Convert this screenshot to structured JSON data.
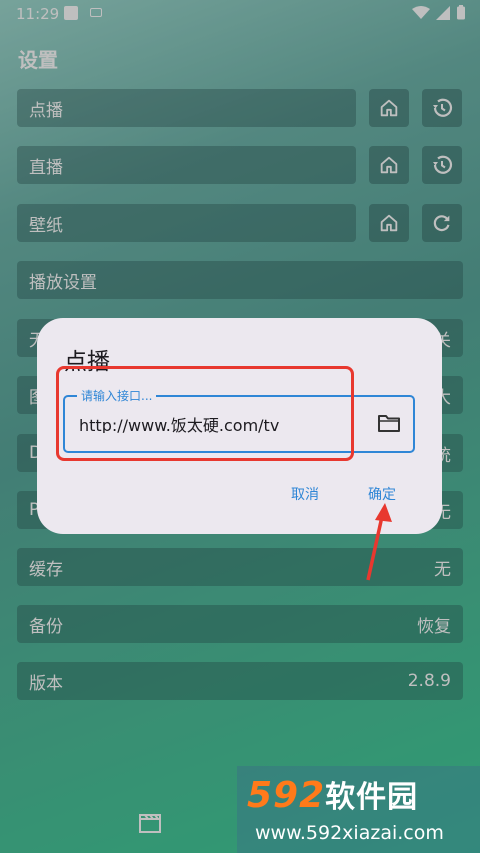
{
  "status": {
    "time": "11:29"
  },
  "page": {
    "title": "设置"
  },
  "rows": {
    "vod": "点播",
    "live": "直播",
    "wallpaper": "壁纸",
    "playback": "播放设置",
    "r5_left": "无",
    "r5_right": "关",
    "r6_left": "图",
    "r6_right": "大",
    "r7_left": "D",
    "r7_right": "统",
    "r8_left": "P",
    "r8_right": "无",
    "cache_label": "缓存",
    "cache_value": "无",
    "backup_label": "备份",
    "backup_value": "恢复",
    "version_label": "版本",
    "version_value": "2.8.9"
  },
  "icons": {
    "home": "home-icon",
    "history": "history-icon",
    "refresh": "refresh-icon",
    "folder": "folder-icon",
    "movie": "clapperboard-icon"
  },
  "dialog": {
    "title": "点播",
    "field_label": "请输入接口...",
    "field_value": "http://www.饭太硬.com/tv",
    "cancel": "取消",
    "confirm": "确定"
  },
  "watermark": {
    "digits": "592",
    "cn": "软件园",
    "url": "www.592xiazai.com"
  },
  "colors": {
    "accent": "#2f86d6",
    "annotation": "#e8382f"
  }
}
